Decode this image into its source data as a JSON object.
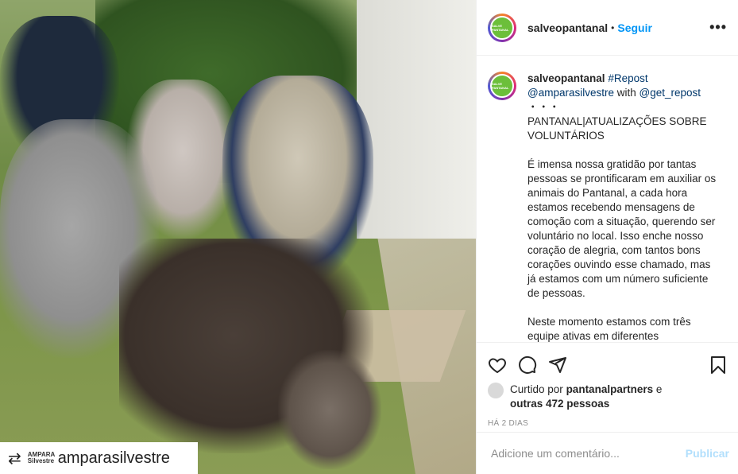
{
  "photo": {
    "watermark_user": "amparasilvestre",
    "watermark_logo": "AMPARA Silvestre"
  },
  "header": {
    "username": "salveopantanal",
    "separator": "•",
    "follow": "Seguir",
    "more": "•••"
  },
  "caption": {
    "username": "salveopantanal",
    "tag1": "#Repost",
    "tag2": "@amparasilvestre",
    "with": "with",
    "tag3": "@get_repost",
    "dots": "・・・",
    "title": "PANTANAL|ATUALIZAÇÕES SOBRE VOLUNTÁRIOS",
    "para1": "É imensa nossa gratidão por tantas pessoas se prontificaram em auxiliar os animais do Pantanal, a cada hora estamos recebendo mensagens de comoção com a situação, querendo ser voluntário no local. Isso enche nosso coração de alegria, com tantos bons corações ouvindo esse chamado, mas já estamos com um número suficiente de pessoas.",
    "para2": "Neste momento estamos com três equipe ativas em diferentes"
  },
  "likes": {
    "prefix": "Curtido por",
    "user": "pantanalpartners",
    "and": "e",
    "others": "outras 472 pessoas"
  },
  "date": "HÁ 2 DIAS",
  "comment": {
    "placeholder": "Adicione um comentário...",
    "publish": "Publicar"
  },
  "avatar_text": "SALVE PANTANAL",
  "colors": {
    "link": "#0095f6",
    "avatar_bg": "#6cbf3a",
    "publish_disabled": "#b2dffc"
  }
}
